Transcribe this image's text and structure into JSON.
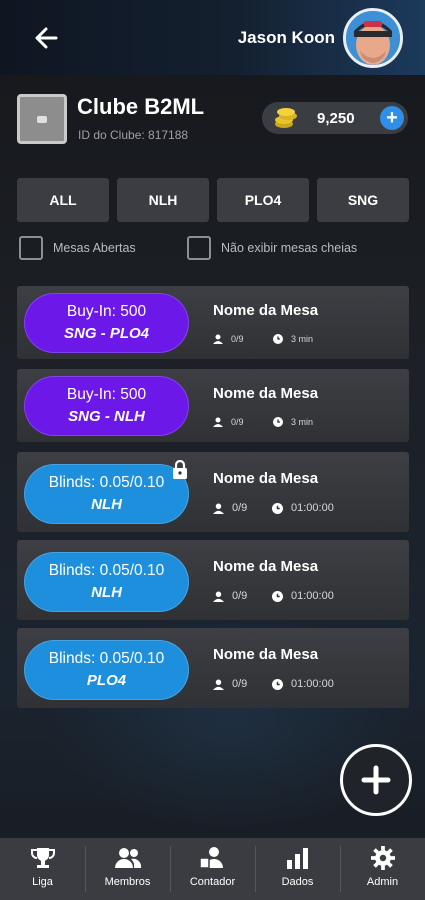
{
  "header": {
    "back_icon": "arrow-left-icon",
    "username": "Jason Koon"
  },
  "club": {
    "name": "Clube B2ML",
    "id_text": "ID do Clube: 817188"
  },
  "balance": {
    "value": "9,250",
    "add_label": "+"
  },
  "filters": [
    {
      "label": "ALL"
    },
    {
      "label": "NLH"
    },
    {
      "label": "PLO4"
    },
    {
      "label": "SNG"
    }
  ],
  "checkboxes": {
    "open_tables": "Mesas Abertas",
    "hide_full": "Não exibir mesas cheias"
  },
  "tables": [
    {
      "line1": "Buy-In: 500",
      "line2": "SNG - PLO4",
      "name": "Nome da Mesa",
      "players": "0/9",
      "time": "3 min",
      "color": "#6b18e8",
      "locked": false
    },
    {
      "line1": "Buy-In: 500",
      "line2": "SNG - NLH",
      "name": "Nome da Mesa",
      "players": "0/9",
      "time": "3 min",
      "color": "#6b18e8",
      "locked": false
    },
    {
      "line1": "Blinds: 0.05/0.10",
      "line2": "NLH",
      "name": "Nome da Mesa",
      "players": "0/9",
      "time": "01:00:00",
      "color": "#1e8fdc",
      "locked": true
    },
    {
      "line1": "Blinds: 0.05/0.10",
      "line2": "NLH",
      "name": "Nome da Mesa",
      "players": "0/9",
      "time": "01:00:00",
      "color": "#1e8fdc",
      "locked": false
    },
    {
      "line1": "Blinds: 0.05/0.10",
      "line2": "PLO4",
      "name": "Nome da Mesa",
      "players": "0/9",
      "time": "01:00:00",
      "color": "#1e8fdc",
      "locked": false
    }
  ],
  "fab_icon": "plus-icon",
  "bottom_nav": [
    {
      "label": "Liga",
      "icon": "trophy-icon"
    },
    {
      "label": "Membros",
      "icon": "members-icon"
    },
    {
      "label": "Contador",
      "icon": "counter-icon"
    },
    {
      "label": "Dados",
      "icon": "bar-chart-icon"
    },
    {
      "label": "Admin",
      "icon": "gear-icon"
    }
  ]
}
